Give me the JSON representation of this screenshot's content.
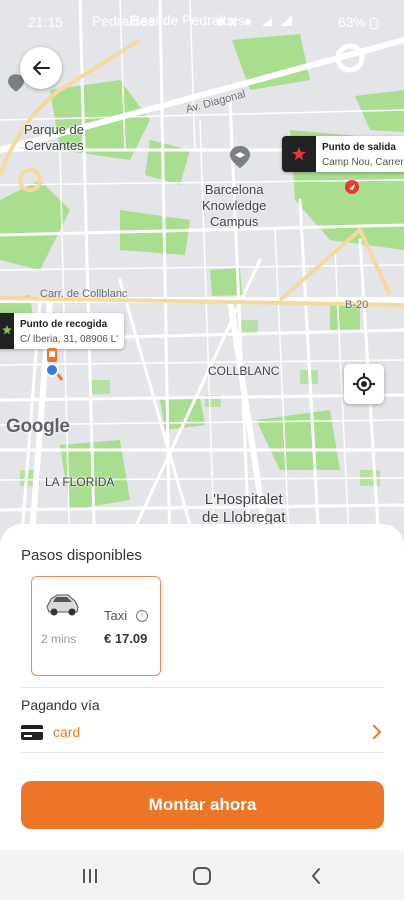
{
  "status_bar": {
    "time": "21:15",
    "battery": "63%",
    "notification_text": "Pedralbes"
  },
  "map": {
    "labels": {
      "parque": "Parque de\nCervantes",
      "campus": "Barcelona\nKnowledge\nCampus",
      "collblanc": "COLLBLANC",
      "florida": "LA FLORIDA",
      "hospitalet": "L'Hospitalet\nde Llobregat",
      "real_pedralbes": "Real de Pedralbes"
    },
    "streets": {
      "diagonal": "Av. Diagonal",
      "collblanc": "Carr. de Collblanc",
      "b20": "B-20"
    },
    "pickup": {
      "title": "Punto de recogida",
      "address": "C/ Iberia, 31, 08906 L'"
    },
    "departure": {
      "title": "Punto de salida",
      "address": "Camp Nou, Carrer d'"
    },
    "attribution": "Google"
  },
  "colors": {
    "accent": "#ec7527",
    "park": "#a9dd8f",
    "road": "#ffffff",
    "highway": "#f5d99e",
    "pin_blue": "#3b7be0"
  },
  "sheet": {
    "steps_title": "Pasos disponibles",
    "option": {
      "eta": "2 mins",
      "name": "Taxi",
      "info_icon": "info-icon",
      "price": "€ 17.09"
    },
    "payment_title": "Pagando vía",
    "payment_method": "card",
    "cta_label": "Montar ahora"
  },
  "nav": {
    "icons": [
      "recents-icon",
      "home-icon",
      "back-icon"
    ]
  }
}
